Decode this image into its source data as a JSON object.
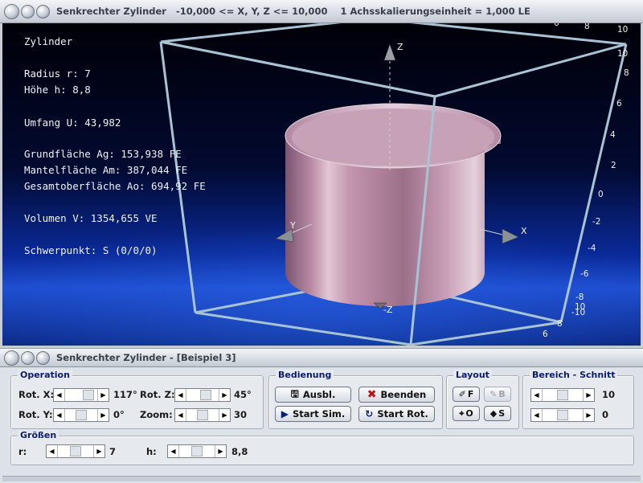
{
  "window3d": {
    "title": "Senkrechter Zylinder   -10,000 <= X, Y, Z <= 10,000    1 Achsskalierungseinheit = 1,000 LE"
  },
  "info": {
    "heading": "Zylinder",
    "radius": "Radius r: 7",
    "height": "Höhe h: 8,8",
    "umfang": "Umfang U: 43,982",
    "grundflaeche": "Grundfläche Ag: 153,938 FE",
    "mantelflaeche": "Mantelfläche Am: 387,044 FE",
    "gesamtoberflaeche": "Gesamtoberfläche Ao: 694,92 FE",
    "volumen": "Volumen V: 1354,655 VE",
    "schwerpunkt": "Schwerpunkt: S (0/0/0)"
  },
  "axes": {
    "x_label": "X",
    "y_label": "Y",
    "z_label": "Z",
    "neg_z_label": "-Z",
    "right_scale": [
      "10",
      "8",
      "6",
      "4",
      "2",
      "0",
      "-2",
      "-4",
      "-6",
      "-8",
      "-10"
    ],
    "top_scale": [
      "6",
      "8",
      "10"
    ],
    "bottom_scale": [
      "10",
      "8",
      "6"
    ]
  },
  "colors": {
    "cylinder": "#c89ab0",
    "box_edges": "#a8c4d4",
    "background_top": "#000010",
    "background_glow": "#1e50d0"
  },
  "controls": {
    "title": "Senkrechter Zylinder - [Beispiel 3]",
    "operation": {
      "label": "Operation",
      "rot_x_label": "Rot. X:",
      "rot_x_value": "117°",
      "rot_x_level": 0.83,
      "rot_y_label": "Rot. Y:",
      "rot_y_value": "0°",
      "rot_y_level": 0.5,
      "rot_z_label": "Rot. Z:",
      "rot_z_value": "45°",
      "rot_z_level": 0.63,
      "zoom_label": "Zoom:",
      "zoom_value": "30",
      "zoom_level": 0.5
    },
    "bedienung": {
      "label": "Bedienung",
      "ausbl": "Ausbl.",
      "beenden": "Beenden",
      "start_sim": "Start Sim.",
      "start_rot": "Start Rot."
    },
    "layout": {
      "label": "Layout",
      "f": "F",
      "b": "B",
      "o": "O",
      "s": "S"
    },
    "bereich": {
      "label": "Bereich - Schnitt",
      "value1": "10",
      "level1": 0.5,
      "value2": "0",
      "level2": 0.5
    },
    "groessen": {
      "label": "Größen",
      "r_label": "r:",
      "r_value": "7",
      "r_level": 0.5,
      "h_label": "h:",
      "h_value": "8,8",
      "h_level": 0.5
    }
  }
}
